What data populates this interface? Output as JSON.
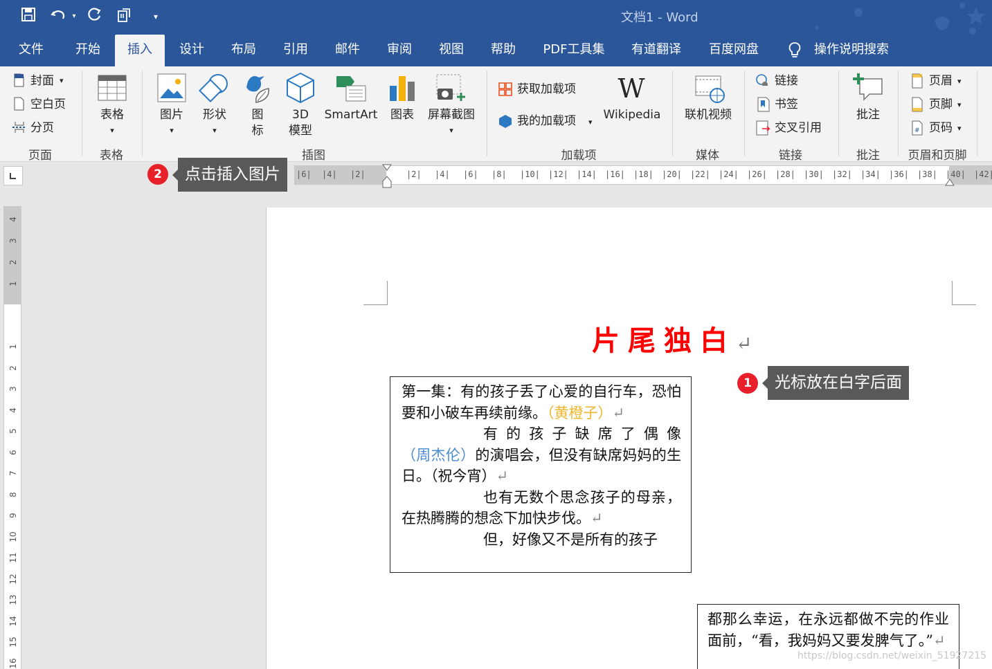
{
  "titlebar": {
    "document_name": "文档1 - Word",
    "icons": [
      "save-icon",
      "undo-icon",
      "undo-dropdown-icon",
      "redo-icon",
      "touch-mode-icon",
      "customize-qat-icon"
    ]
  },
  "tabs": [
    {
      "label": "文件"
    },
    {
      "label": "开始"
    },
    {
      "label": "插入",
      "active": true
    },
    {
      "label": "设计"
    },
    {
      "label": "布局"
    },
    {
      "label": "引用"
    },
    {
      "label": "邮件"
    },
    {
      "label": "审阅"
    },
    {
      "label": "视图"
    },
    {
      "label": "帮助"
    },
    {
      "label": "PDF工具集"
    },
    {
      "label": "有道翻译"
    },
    {
      "label": "百度网盘"
    },
    {
      "label": "操作说明搜索",
      "icon": "lightbulb-icon"
    }
  ],
  "ribbon": {
    "pages": {
      "label": "页面",
      "cover": "封面",
      "blank": "空白页",
      "break": "分页"
    },
    "tables": {
      "label": "表格",
      "table": "表格"
    },
    "illustrations": {
      "label": "插图",
      "picture": "图片",
      "shapes": "形状",
      "icons": "图\n标",
      "model": "3D\n模型",
      "smartart": "SmartArt",
      "chart": "图表",
      "screenshot": "屏幕截图"
    },
    "addins": {
      "label": "加载项",
      "get": "获取加载项",
      "my": "我的加载项",
      "wikipedia": "Wikipedia"
    },
    "media": {
      "label": "媒体",
      "video": "联机视频"
    },
    "links": {
      "label": "链接",
      "link": "链接",
      "bookmark": "书签",
      "crossref": "交叉引用"
    },
    "comments": {
      "label": "批注",
      "comment": "批注"
    },
    "headerfooter": {
      "label": "页眉和页脚",
      "header": "页眉",
      "footer": "页脚",
      "pagenumber": "页码"
    }
  },
  "ruler": {
    "left_ticks": [
      "6",
      "4",
      "2"
    ],
    "right_ticks": [
      "2",
      "4",
      "6",
      "8",
      "10",
      "12",
      "14",
      "16",
      "18",
      "20",
      "22",
      "24",
      "26",
      "28",
      "30",
      "32",
      "34",
      "36",
      "38",
      "40",
      "42"
    ],
    "vertical_top": [
      "4",
      "3",
      "2",
      "1"
    ],
    "vertical_bottom": [
      "1",
      "2",
      "3",
      "4",
      "5",
      "6",
      "7",
      "8",
      "9",
      "10",
      "11",
      "12",
      "13",
      "14",
      "15",
      "16"
    ]
  },
  "document": {
    "heading": "片尾独白",
    "box1": {
      "p1_a": "第一集：有的孩子丢了心爱的自行车，恐怕要和小破车再续前缘。",
      "p1_orange": "（黄橙子）",
      "p2_a": "有的孩子缺席了偶像",
      "p2_blue": "（周杰伦）",
      "p2_b": "的演唱会，但没有缺席妈妈的生日。（祝今宵）",
      "p3": "也有无数个思念孩子的母亲，在热腾腾的想念下加快步伐。",
      "p4": "但，好像又不是所有的孩子"
    },
    "box2": {
      "text": "都那么幸运，在永远都做不完的作业面前，“看，我妈妈又要发脾气了。”"
    },
    "paragraph_mark": "↵"
  },
  "annotations": {
    "callout1": {
      "badge": "1",
      "text": "光标放在白字后面"
    },
    "callout2": {
      "badge": "2",
      "text": "点击插入图片"
    }
  },
  "watermark": "https://blog.csdn.net/weixin_51927215",
  "colors": {
    "brand": "#2b579a",
    "heading": "#ff0000",
    "orange_text": "#f0b52b",
    "blue_text": "#4a8bd1",
    "callout_bg": "#595959",
    "badge": "#e8202a"
  }
}
